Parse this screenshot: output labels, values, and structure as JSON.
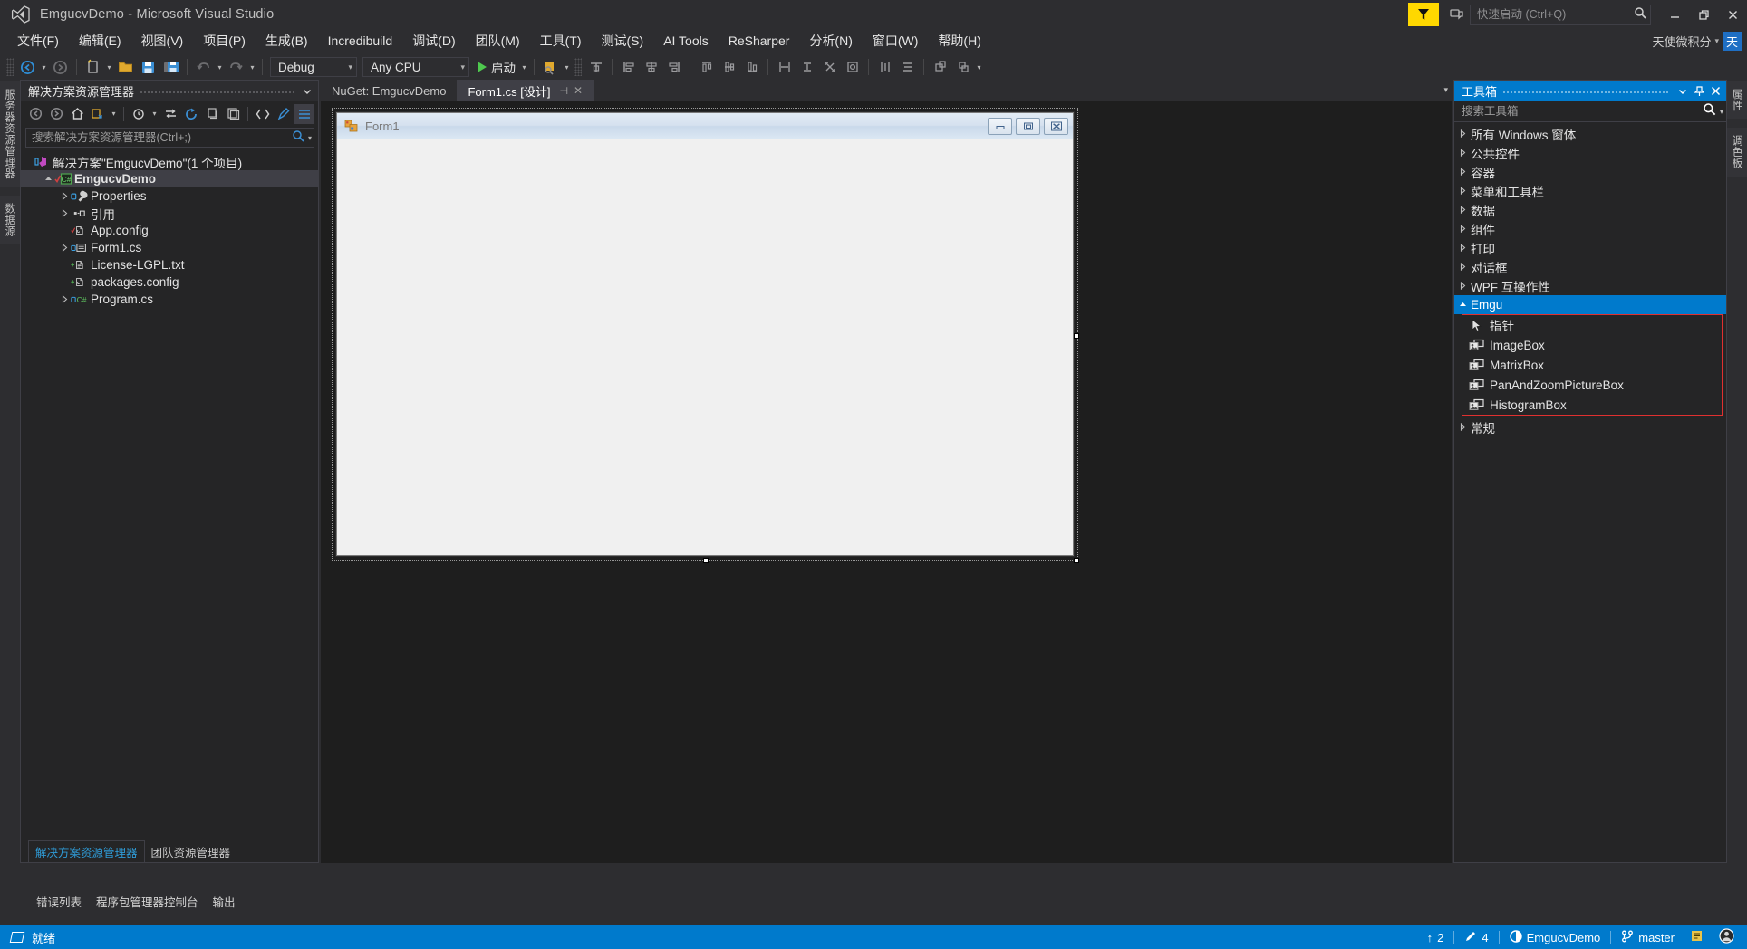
{
  "titlebar": {
    "title": "EmgucvDemo - Microsoft Visual Studio",
    "logo_icon": "visual-studio-logo-icon",
    "notification_icon": "notification-flag-icon",
    "feedback_icon": "feedback-smiley-icon",
    "quicklaunch_placeholder": "快速启动 (Ctrl+Q)",
    "quicklaunch_value": "",
    "search_icon": "search-icon",
    "minimize_icon": "minimize-icon",
    "restore_icon": "restore-icon",
    "close_icon": "close-icon"
  },
  "menubar": {
    "items": [
      "文件(F)",
      "编辑(E)",
      "视图(V)",
      "项目(P)",
      "生成(B)",
      "Incredibuild",
      "调试(D)",
      "团队(M)",
      "工具(T)",
      "测试(S)",
      "AI Tools",
      "ReSharper",
      "分析(N)",
      "窗口(W)",
      "帮助(H)"
    ],
    "account_name": "天使微积分",
    "account_caret": "▾",
    "account_avatar": "天"
  },
  "toolbar": {
    "nav_back_icon": "navigate-back-icon",
    "nav_forward_icon": "navigate-forward-icon",
    "new_project_icon": "new-project-icon",
    "open_file_icon": "open-file-icon",
    "save_icon": "save-icon",
    "save_all_icon": "save-all-icon",
    "undo_icon": "undo-icon",
    "redo_icon": "redo-icon",
    "config_value": "Debug",
    "platform_value": "Any CPU",
    "start_label": "启动",
    "start_icon": "play-triangle-icon",
    "find_icon": "find-in-files-icon",
    "align_icons": [
      "align-to-grid-icon",
      "align-lefts-icon",
      "align-centers-icon",
      "align-rights-icon",
      "align-tops-icon",
      "align-middles-icon",
      "align-bottoms-icon",
      "make-same-width-icon",
      "make-same-height-icon",
      "make-same-size-icon",
      "size-to-grid-icon",
      "horizontal-spacing-icon",
      "vertical-spacing-icon",
      "bring-to-front-icon",
      "send-to-back-icon"
    ],
    "overflow_caret": "▾"
  },
  "vertical_tabs": {
    "left": [
      "服务器资源管理器",
      "数据源"
    ],
    "right": [
      "属性",
      "调色板"
    ]
  },
  "solution_explorer": {
    "title": "解决方案资源管理器",
    "header_caret_icon": "chevron-down-icon",
    "pin_icon": "pin-icon",
    "close_icon": "close-icon",
    "toolbar_icons": [
      "back-arrow-icon",
      "forward-arrow-icon",
      "home-icon",
      "sync-with-active-document-icon",
      "pending-changes-filter-icon",
      "refresh-icon",
      "collapse-all-icon",
      "show-all-files-icon",
      "properties-window-icon",
      "view-code-icon",
      "view-designer-icon",
      "properties-icon"
    ],
    "search_placeholder": "搜索解决方案资源管理器(Ctrl+;)",
    "search_value": "",
    "search_icon": "search-icon",
    "tree": [
      {
        "label": "解决方案\"EmgucvDemo\"(1 个项目)",
        "indent": 0,
        "twist": "",
        "icon": "solution-icon",
        "bold": false,
        "selected": false
      },
      {
        "label": "EmgucvDemo",
        "indent": 1,
        "twist": "▴",
        "icon": "csharp-project-icon",
        "bold": true,
        "selected": true
      },
      {
        "label": "Properties",
        "indent": 2,
        "twist": "▸",
        "icon": "properties-wrench-icon",
        "bold": false,
        "selected": false
      },
      {
        "label": "引用",
        "indent": 2,
        "twist": "▸",
        "icon": "references-icon",
        "bold": false,
        "selected": false
      },
      {
        "label": "App.config",
        "indent": 3,
        "twist": "",
        "icon": "config-file-icon",
        "bold": false,
        "selected": false
      },
      {
        "label": "Form1.cs",
        "indent": 2,
        "twist": "▸",
        "icon": "form-file-icon",
        "bold": false,
        "selected": false
      },
      {
        "label": "License-LGPL.txt",
        "indent": 3,
        "twist": "",
        "icon": "text-file-icon",
        "bold": false,
        "selected": false
      },
      {
        "label": "packages.config",
        "indent": 3,
        "twist": "",
        "icon": "config-file-icon",
        "bold": false,
        "selected": false
      },
      {
        "label": "Program.cs",
        "indent": 2,
        "twist": "▸",
        "icon": "csharp-file-icon",
        "bold": false,
        "selected": false
      }
    ],
    "bottom_tabs": [
      {
        "label": "解决方案资源管理器",
        "active": true
      },
      {
        "label": "团队资源管理器",
        "active": false
      }
    ]
  },
  "document_tabs": {
    "tabs": [
      {
        "label": "NuGet: EmgucvDemo",
        "active": false
      },
      {
        "label": "Form1.cs [设计]",
        "active": true,
        "pin_icon": "pin-icon",
        "close_icon": "close-icon"
      }
    ],
    "overflow_caret": "▾"
  },
  "designer": {
    "form": {
      "title": "Form1",
      "icon": "windows-form-icon",
      "minimize_icon": "minimize-icon",
      "maximize_icon": "maximize-icon",
      "close_icon": "close-icon"
    }
  },
  "toolbox": {
    "title": "工具箱",
    "header_caret_icon": "chevron-down-icon",
    "pin_icon": "pin-icon",
    "close_icon": "close-icon",
    "search_placeholder": "搜索工具箱",
    "search_value": "",
    "search_icon": "search-icon",
    "search_caret": "▾",
    "categories": [
      {
        "label": "所有 Windows 窗体",
        "expanded": false,
        "active": false
      },
      {
        "label": "公共控件",
        "expanded": false,
        "active": false
      },
      {
        "label": "容器",
        "expanded": false,
        "active": false
      },
      {
        "label": "菜单和工具栏",
        "expanded": false,
        "active": false
      },
      {
        "label": "数据",
        "expanded": false,
        "active": false
      },
      {
        "label": "组件",
        "expanded": false,
        "active": false
      },
      {
        "label": "打印",
        "expanded": false,
        "active": false
      },
      {
        "label": "对话框",
        "expanded": false,
        "active": false
      },
      {
        "label": "WPF 互操作性",
        "expanded": false,
        "active": false
      },
      {
        "label": "Emgu",
        "expanded": true,
        "active": true
      }
    ],
    "emgu_items": [
      {
        "label": "指针",
        "icon": "pointer-arrow-icon"
      },
      {
        "label": "ImageBox",
        "icon": "control-box-icon"
      },
      {
        "label": "MatrixBox",
        "icon": "control-box-icon"
      },
      {
        "label": "PanAndZoomPictureBox",
        "icon": "control-box-icon"
      },
      {
        "label": "HistogramBox",
        "icon": "control-box-icon"
      }
    ],
    "trailing_category": {
      "label": "常规",
      "expanded": false
    },
    "highlight_color": "#e03030"
  },
  "bottom_tabs": [
    "错误列表",
    "程序包管理器控制台",
    "输出"
  ],
  "statusbar": {
    "ready_icon": "ready-flag-icon",
    "ready_text": "就绪",
    "up_arrow": "↑",
    "up_count": "2",
    "pencil_icon": "pencil-edit-icon",
    "edit_count": "4",
    "source_control_icon": "source-control-icon",
    "repo_name": "EmgucvDemo",
    "branch_icon": "branch-icon",
    "branch_name": "master",
    "notify_icon": "notification-bell-icon",
    "account_icon": "user-account-icon",
    "accent_color": "#007acc"
  }
}
